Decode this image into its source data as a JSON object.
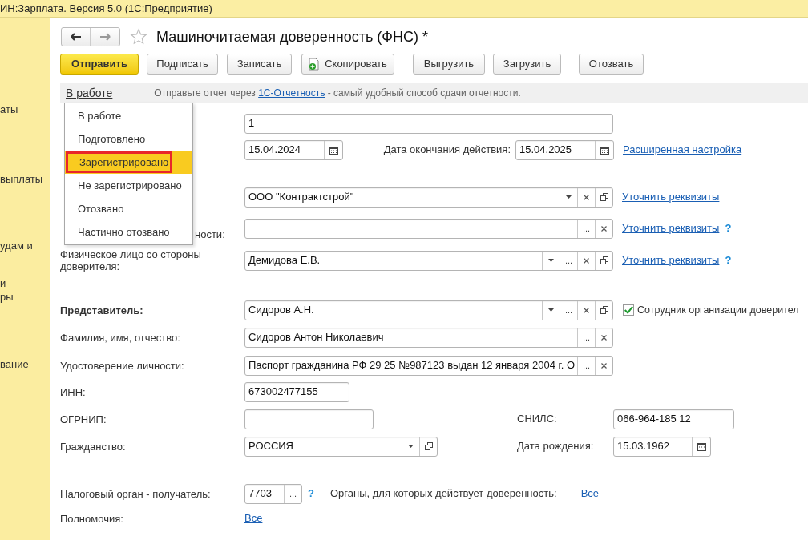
{
  "window": {
    "title": "ИН:Зарплата. Версия 5.0  (1С:Предприятие)"
  },
  "sidebar": {
    "items": [
      {
        "lines": [
          "аты"
        ]
      },
      {
        "lines": [
          "выплаты"
        ]
      },
      {
        "lines": [
          "удам и"
        ]
      },
      {
        "lines": [
          "и",
          "ры"
        ]
      },
      {
        "lines": [
          "вание"
        ]
      }
    ]
  },
  "form": {
    "title": "Машиночитаемая доверенность (ФНС) *",
    "toolbar": [
      {
        "label": "Отправить",
        "kind": "primary"
      },
      {
        "label": "Подписать",
        "kind": "plain"
      },
      {
        "label": "Записать",
        "kind": "plain"
      },
      {
        "label": "Скопировать",
        "kind": "copy"
      },
      {
        "label": "Выгрузить",
        "kind": "plain"
      },
      {
        "label": "Загрузить",
        "kind": "plain"
      },
      {
        "label": "Отозвать",
        "kind": "plain"
      }
    ],
    "status": {
      "current": "В работе",
      "hint_before": "Отправьте отчет через",
      "hint_link": "1С-Отчетность",
      "hint_after": "- самый удобный способ сдачи отчетности."
    },
    "status_menu": [
      {
        "label": "В работе",
        "selected": false
      },
      {
        "label": "Подготовлено",
        "selected": false
      },
      {
        "label": "Зарегистрировано",
        "selected": true,
        "highlighted": true
      },
      {
        "label": "Не зарегистрировано",
        "selected": false
      },
      {
        "label": "Отозвано",
        "selected": false
      },
      {
        "label": "Частично отозвано",
        "selected": false
      }
    ],
    "rows": [
      {
        "cells": [
          {
            "kind": "input",
            "value": "1"
          }
        ]
      },
      {
        "cells": [
          {
            "kind": "date",
            "value": "15.04.2024"
          },
          {
            "kind": "label",
            "text": "Дата окончания действия:"
          },
          {
            "kind": "date",
            "value": "15.04.2025"
          }
        ],
        "link": "Расширенная настройка"
      },
      {
        "cells": [
          {
            "kind": "input",
            "value": "ООО \"Контрактстрой\"",
            "buttons": [
              {
                "kind": "choice"
              },
              {
                "kind": "clear"
              },
              {
                "kind": "open"
              }
            ]
          }
        ],
        "link": "Уточнить реквизиты"
      },
      {
        "label_tail": "ности:",
        "cells": [
          {
            "kind": "input",
            "buttons": [
              {
                "kind": "select",
                "label": "..."
              },
              {
                "kind": "clear"
              }
            ]
          }
        ],
        "link": "Уточнить реквизиты",
        "help": "?"
      },
      {
        "label_lines": [
          [
            "Физическое лицо со стороны"
          ],
          [
            "доверителя:"
          ]
        ],
        "cells": [
          {
            "kind": "input",
            "value": "Демидова Е.В.",
            "buttons": [
              {
                "kind": "choice"
              },
              {
                "kind": "select",
                "label": "..."
              },
              {
                "kind": "clear"
              },
              {
                "kind": "open"
              }
            ]
          }
        ],
        "link": "Уточнить реквизиты",
        "help": "?"
      },
      {
        "label_lines": [
          [
            "Представитель:"
          ]
        ],
        "bold": true,
        "cells": [
          {
            "kind": "input",
            "value": "Сидоров А.Н.",
            "buttons": [
              {
                "kind": "choice"
              },
              {
                "kind": "select",
                "label": "..."
              },
              {
                "kind": "clear"
              },
              {
                "kind": "open"
              }
            ]
          }
        ],
        "checkbox": {
          "checked": true,
          "text": "Сотрудник организации доверител"
        }
      },
      {
        "label_lines": [
          [
            "Фамилия, имя, отчество:"
          ]
        ],
        "cells": [
          {
            "kind": "input",
            "value": "Сидоров Антон Николаевич",
            "buttons": [
              {
                "kind": "select",
                "label": "..."
              },
              {
                "kind": "clear"
              }
            ]
          }
        ]
      },
      {
        "label_lines": [
          [
            "Удостоверение личности:"
          ]
        ],
        "cells": [
          {
            "kind": "input",
            "value": "Паспорт гражданина РФ 29 25 №987123 выдан 12 января 2004 г. О",
            "buttons": [
              {
                "kind": "select",
                "label": "..."
              },
              {
                "kind": "clear"
              }
            ]
          }
        ]
      },
      {
        "label_lines": [
          [
            "ИНН:"
          ]
        ],
        "cells": [
          {
            "kind": "input",
            "value": "673002477155"
          }
        ]
      },
      {
        "label_lines": [
          [
            "ОГРНИП:"
          ]
        ],
        "cells": [
          {
            "kind": "input"
          },
          {
            "kind": "label",
            "text": "СНИЛС:"
          },
          {
            "kind": "input",
            "value": "066-964-185 12"
          }
        ]
      },
      {
        "label_lines": [
          [
            "Гражданство:"
          ]
        ],
        "cells": [
          {
            "kind": "input",
            "value": "РОССИЯ",
            "buttons": [
              {
                "kind": "choice"
              },
              {
                "kind": "open"
              }
            ]
          },
          {
            "kind": "label",
            "text": "Дата рождения:"
          },
          {
            "kind": "date",
            "value": "15.03.1962"
          }
        ]
      },
      {
        "label_lines": [
          [
            "Налоговый орган - получатель:"
          ]
        ],
        "cells": [
          {
            "kind": "input",
            "value": "7703",
            "buttons": [
              {
                "kind": "select",
                "label": "..."
              }
            ]
          },
          {
            "kind": "help",
            "text": "?"
          },
          {
            "kind": "label",
            "text": "Органы, для которых действует доверенность:"
          },
          {
            "kind": "link",
            "text": "Все"
          }
        ]
      },
      {
        "label_lines": [
          [
            "Полномочия:"
          ]
        ],
        "cells": [
          {
            "kind": "link",
            "text": "Все"
          }
        ]
      }
    ]
  }
}
